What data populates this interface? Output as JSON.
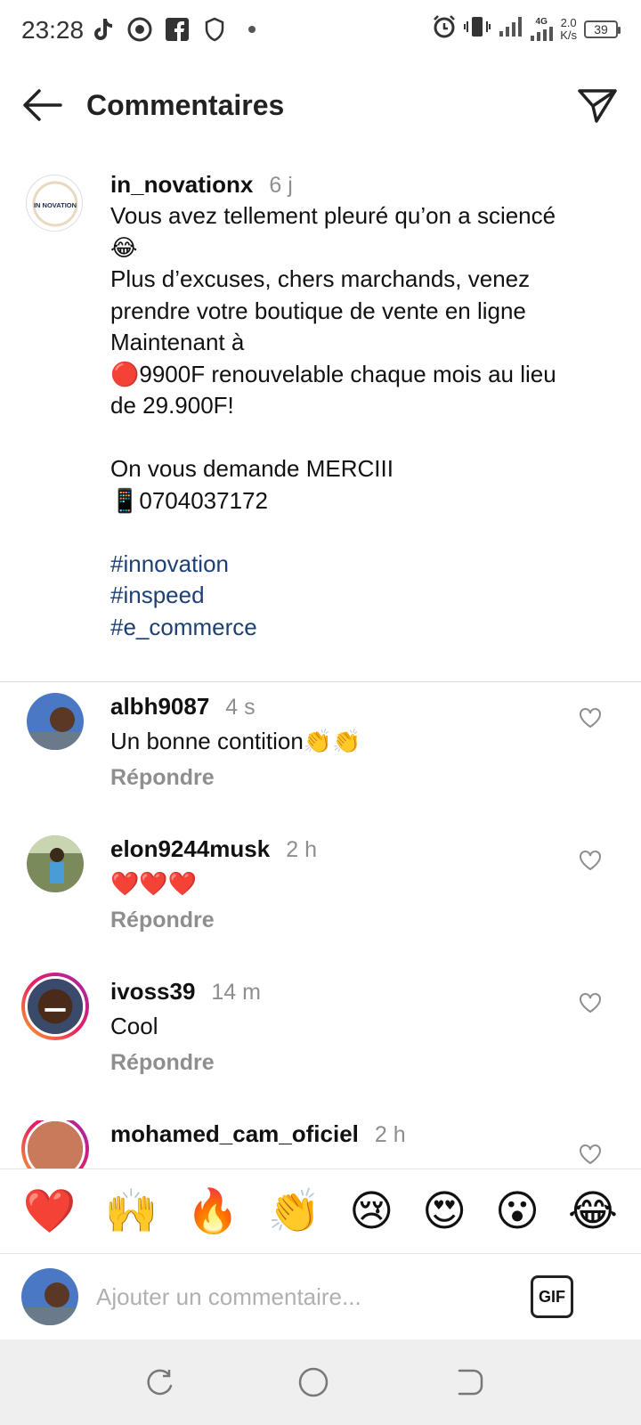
{
  "status_bar": {
    "time": "23:28",
    "network": "4G",
    "net_speed_value": "2.0",
    "net_speed_unit": "K/s",
    "battery": "39"
  },
  "header": {
    "title": "Commentaires"
  },
  "caption": {
    "username": "in_novationx",
    "time": "6 j",
    "avatar_text": "IN NOVATION",
    "text": "Vous avez tellement pleuré qu’on a sciencé😂\nPlus d’excuses, chers marchands, venez prendre votre boutique de vente en ligne Maintenant à\n🔴9900F renouvelable chaque mois au lieu de 29.900F!\n\nOn vous  demande MERCIII\n📱0704037172\n\n",
    "hashtags": [
      "#innovation",
      "#inspeed",
      "#e_commerce"
    ]
  },
  "comments": [
    {
      "username": "albh9087",
      "time": "4 s",
      "text": "Un bonne contition👏👏",
      "reply": "Répondre"
    },
    {
      "username": "elon9244musk",
      "time": "2 h",
      "text": "❤️❤️❤️",
      "reply": "Répondre"
    },
    {
      "username": "ivoss39",
      "time": "14 m",
      "text": "Cool",
      "reply": "Répondre"
    },
    {
      "username": "mohamed_cam_oficiel",
      "time": "2 h",
      "text": "",
      "reply": ""
    }
  ],
  "emoji_bar": [
    "❤️",
    "🙌",
    "🔥",
    "👏",
    "😢",
    "😍",
    "😮",
    "😂"
  ],
  "input": {
    "placeholder": "Ajouter un commentaire...",
    "gif_label": "GIF"
  },
  "colors": {
    "hashtag": "#1d3f73",
    "muted": "#8e8e8e",
    "story_ring_start": "#f9a825",
    "story_ring_end": "#9c27b0"
  }
}
